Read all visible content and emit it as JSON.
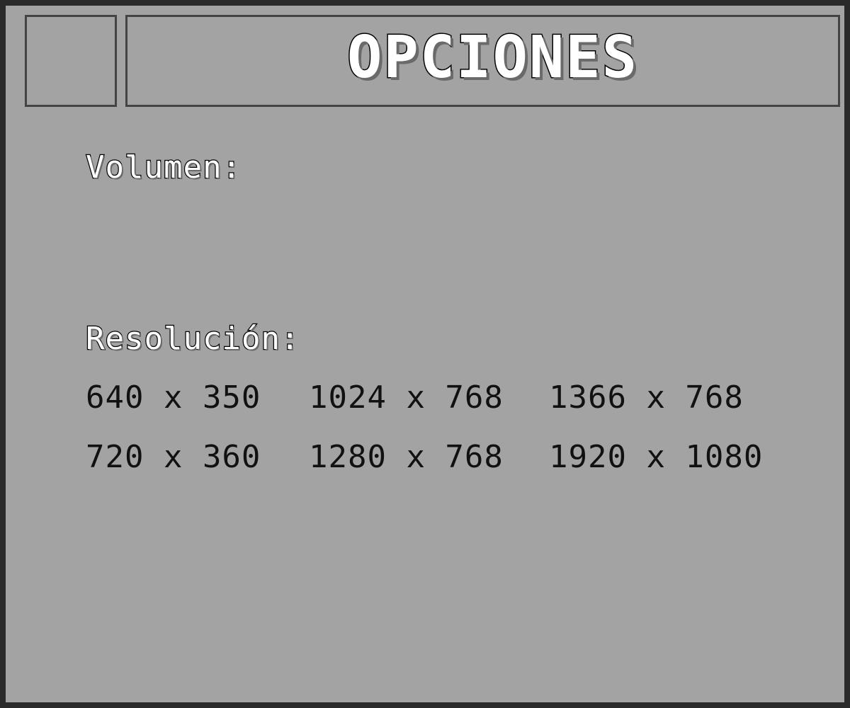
{
  "title": "OPCIONES",
  "volume_label": "Volumen:",
  "resolution_label": "Resolución:",
  "resolutions": [
    [
      "640 x 350",
      "1024 x 768",
      "1366 x 768"
    ],
    [
      "720 x 360",
      "1280 x 768",
      "1920 x 1080"
    ]
  ],
  "colors": {
    "background": "#a3a3a3",
    "frame": "#2a2a2a",
    "box_border": "#444444"
  }
}
